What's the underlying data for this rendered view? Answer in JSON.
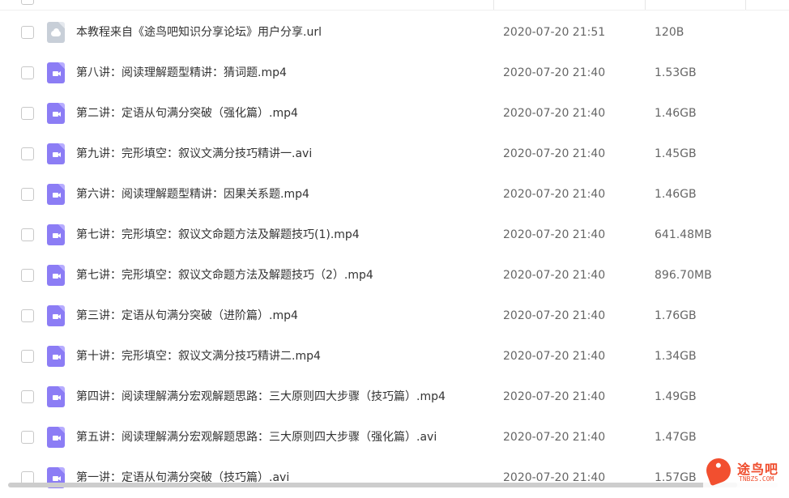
{
  "files": [
    {
      "type": "url",
      "name": "本教程来自《途鸟吧知识分享论坛》用户分享.url",
      "date": "2020-07-20 21:51",
      "size": "120B"
    },
    {
      "type": "video",
      "name": "第八讲：阅读理解题型精讲：猜词题.mp4",
      "date": "2020-07-20 21:40",
      "size": "1.53GB"
    },
    {
      "type": "video",
      "name": "第二讲：定语从句满分突破（强化篇）.mp4",
      "date": "2020-07-20 21:40",
      "size": "1.46GB"
    },
    {
      "type": "video",
      "name": "第九讲：完形填空：叙议文满分技巧精讲一.avi",
      "date": "2020-07-20 21:40",
      "size": "1.45GB"
    },
    {
      "type": "video",
      "name": "第六讲：阅读理解题型精讲：因果关系题.mp4",
      "date": "2020-07-20 21:40",
      "size": "1.46GB"
    },
    {
      "type": "video",
      "name": "第七讲：完形填空：叙议文命题方法及解题技巧(1).mp4",
      "date": "2020-07-20 21:40",
      "size": "641.48MB"
    },
    {
      "type": "video",
      "name": "第七讲：完形填空：叙议文命题方法及解题技巧（2）.mp4",
      "date": "2020-07-20 21:40",
      "size": "896.70MB"
    },
    {
      "type": "video",
      "name": "第三讲：定语从句满分突破（进阶篇）.mp4",
      "date": "2020-07-20 21:40",
      "size": "1.76GB"
    },
    {
      "type": "video",
      "name": "第十讲：完形填空：叙议文满分技巧精讲二.mp4",
      "date": "2020-07-20 21:40",
      "size": "1.34GB"
    },
    {
      "type": "video",
      "name": "第四讲：阅读理解满分宏观解题思路：三大原则四大步骤（技巧篇）.mp4",
      "date": "2020-07-20 21:40",
      "size": "1.49GB"
    },
    {
      "type": "video",
      "name": "第五讲：阅读理解满分宏观解题思路：三大原则四大步骤（强化篇）.avi",
      "date": "2020-07-20 21:40",
      "size": "1.47GB"
    },
    {
      "type": "video",
      "name": "第一讲：定语从句满分突破（技巧篇）.avi",
      "date": "2020-07-20 21:40",
      "size": "1.57GB"
    }
  ],
  "watermark": {
    "cn": "途鸟吧",
    "en": "TNBZS.COM"
  },
  "colors": {
    "video_icon": "#8c7df5",
    "url_icon": "#c8cfd8",
    "watermark": "#ef4a2a"
  }
}
